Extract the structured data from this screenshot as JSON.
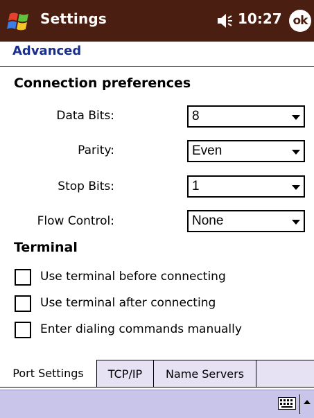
{
  "titlebar": {
    "title": "Settings",
    "time": "10:27",
    "ok_label": "ok"
  },
  "header": {
    "title": "Advanced"
  },
  "connection": {
    "section_title": "Connection preferences",
    "fields": [
      {
        "label": "Data Bits:",
        "value": "8"
      },
      {
        "label": "Parity:",
        "value": "Even"
      },
      {
        "label": "Stop Bits:",
        "value": "1"
      },
      {
        "label": "Flow Control:",
        "value": "None"
      }
    ]
  },
  "terminal": {
    "section_title": "Terminal",
    "options": [
      {
        "label": "Use terminal before connecting",
        "checked": false
      },
      {
        "label": "Use terminal after connecting",
        "checked": false
      },
      {
        "label": "Enter dialing commands manually",
        "checked": false
      }
    ]
  },
  "tabs": [
    {
      "label": "Port Settings",
      "active": true
    },
    {
      "label": "TCP/IP",
      "active": false
    },
    {
      "label": "Name Servers",
      "active": false
    }
  ],
  "colors": {
    "titlebar_bg": "#4a1e10",
    "header_text": "#1a2e8c",
    "menubar_bg": "#c8c4ea",
    "tab_inactive_bg": "#e6e1f3"
  },
  "icons": {
    "start": "windows-flag-icon",
    "volume": "speaker-icon",
    "keyboard": "keyboard-icon",
    "sip_toggle": "up-arrow-icon"
  }
}
